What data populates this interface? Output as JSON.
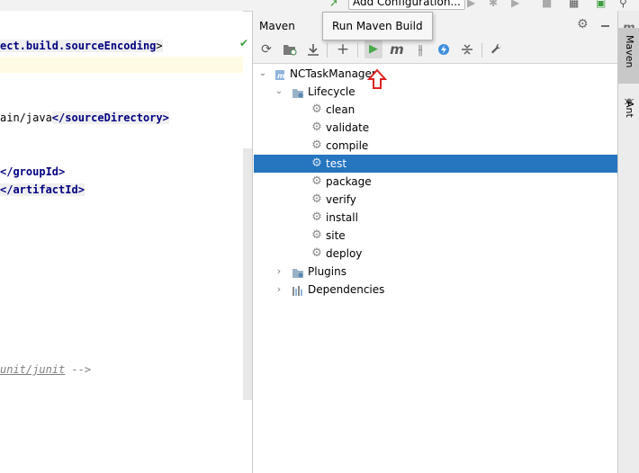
{
  "toolbar": {
    "run_config_label": "Add Configuration..."
  },
  "editor": {
    "lines": {
      "l1_tag": "ect.build.sourceEncoding",
      "l1_close": ">",
      "l2_text": "ain/java",
      "l2_tag": "</sourceDirectory>",
      "l3_tag": "</groupId>",
      "l4_tag": "</artifactId>",
      "l5_link": "unit/junit",
      "l5_end": " -->"
    }
  },
  "maven": {
    "title": "Maven",
    "tooltip": "Run Maven Build",
    "toolbar_icons": [
      "reload-icon",
      "generate-sources-icon",
      "download-icon",
      "add-icon",
      "run-icon",
      "maven-goal-icon",
      "toggle-offline-icon",
      "skip-tests-icon",
      "collapse-all-icon",
      "settings-wrench-icon"
    ],
    "tree": {
      "project": "NCTaskManager",
      "lifecycle": "Lifecycle",
      "goals": [
        "clean",
        "validate",
        "compile",
        "test",
        "package",
        "verify",
        "install",
        "site",
        "deploy"
      ],
      "selected": "test",
      "plugins": "Plugins",
      "dependencies": "Dependencies"
    }
  },
  "side_bar": {
    "maven_tab": "Maven",
    "ant_tab": "Ant"
  },
  "colors": {
    "selection": "#2675bf",
    "accent_red": "#e02020",
    "run_green": "#4aa84a"
  }
}
